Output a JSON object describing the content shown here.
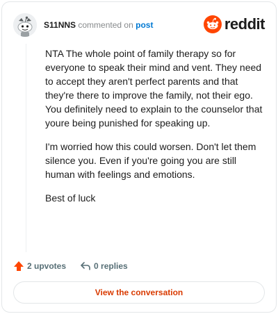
{
  "header": {
    "username": "S11NNS",
    "commented_on": "commented on",
    "post_link": "post",
    "logo_text": "reddit"
  },
  "comment": {
    "paragraphs": [
      "NTA The whole point of family therapy so for everyone to speak their mind and vent. They need to accept they aren't perfect parents and that they're there to improve the family, not their ego. You definitely need to explain to the counselor that youre being punished for speaking up.",
      "I'm worried how this could worsen. Don't let them silence you. Even if you're going you are still human with feelings and emotions.",
      "Best of luck"
    ]
  },
  "actions": {
    "upvotes": "2 upvotes",
    "replies": "0 replies"
  },
  "cta": {
    "label": "View the conversation"
  },
  "colors": {
    "brand": "#ff4500",
    "link": "#0079d3",
    "cta_text": "#d93a00"
  }
}
